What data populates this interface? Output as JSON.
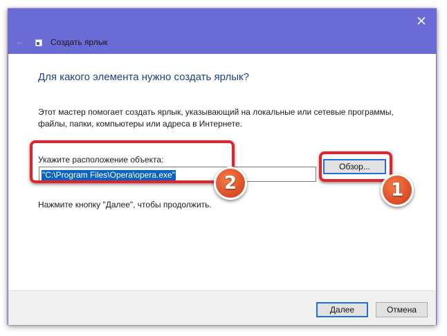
{
  "window": {
    "title": "Создать ярлык",
    "close_glyph": "✕",
    "back_glyph": "←"
  },
  "main": {
    "heading": "Для какого элемента нужно создать ярлык?",
    "description": "Этот мастер помогает создать ярлык, указывающий на локальные или сетевые программы, файлы, папки, компьютеры или адреса в Интернете.",
    "location_label": "Укажите расположение объекта:",
    "location_value": "\"C:\\Program Files\\Opera\\opera.exe\"",
    "browse_label": "Обзор...",
    "hint": "Нажмите кнопку \"Далее\", чтобы продолжить."
  },
  "footer": {
    "next_label": "Далее",
    "cancel_label": "Отмена"
  },
  "annotations": {
    "badge_browse": "1",
    "badge_input": "2"
  },
  "icons": [
    "close-icon",
    "back-arrow-icon",
    "shortcut-app-icon"
  ],
  "colors": {
    "titlebar": "#6b6bd6",
    "heading": "#1e3e8c",
    "selection": "#0b64c0",
    "highlight": "#e8202a",
    "badge": "#e0552c"
  }
}
